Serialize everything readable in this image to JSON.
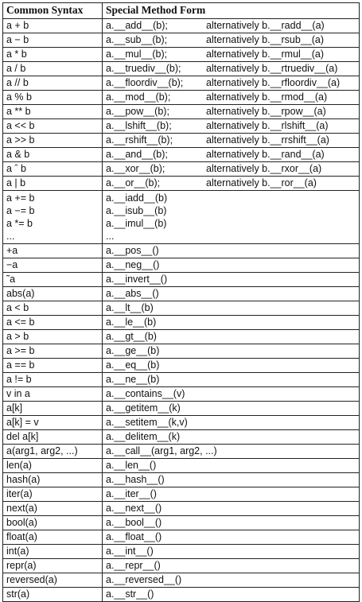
{
  "headers": {
    "syntax": "Common Syntax",
    "method": "Special Method Form"
  },
  "rows": [
    {
      "syntax": "a + b",
      "method": "a.__add__(b);",
      "alt": "alternatively b.__radd__(a)"
    },
    {
      "syntax": "a − b",
      "method": "a.__sub__(b);",
      "alt": "alternatively b.__rsub__(a)"
    },
    {
      "syntax": "a * b",
      "method": "a.__mul__(b);",
      "alt": "alternatively b.__rmul__(a)"
    },
    {
      "syntax": "a / b",
      "method": "a.__truediv__(b);",
      "alt": "alternatively b.__rtruediv__(a)"
    },
    {
      "syntax": "a // b",
      "method": "a.__floordiv__(b);",
      "alt": "alternatively b.__rfloordiv__(a)"
    },
    {
      "syntax": "a % b",
      "method": "a.__mod__(b);",
      "alt": "alternatively b.__rmod__(a)"
    },
    {
      "syntax": "a ** b",
      "method": "a.__pow__(b);",
      "alt": "alternatively b.__rpow__(a)"
    },
    {
      "syntax": "a << b",
      "method": "a.__lshift__(b);",
      "alt": "alternatively b.__rlshift__(a)"
    },
    {
      "syntax": "a >> b",
      "method": "a.__rshift__(b);",
      "alt": "alternatively b.__rrshift__(a)"
    },
    {
      "syntax": "a & b",
      "method": "a.__and__(b);",
      "alt": "alternatively b.__rand__(a)"
    },
    {
      "syntax": "a ˆ b",
      "method": "a.__xor__(b);",
      "alt": "alternatively b.__rxor__(a)"
    },
    {
      "syntax": "a | b",
      "method": "a.__or__(b);",
      "alt": "alternatively b.__ror__(a)"
    }
  ],
  "inplace": {
    "syntax": [
      "a += b",
      "a −= b",
      "a *= b",
      "..."
    ],
    "method": [
      "a.__iadd__(b)",
      "a.__isub__(b)",
      "a.__imul__(b)",
      "..."
    ]
  },
  "rows2": [
    {
      "syntax": "+a",
      "method": "a.__pos__()"
    },
    {
      "syntax": "−a",
      "method": "a.__neg__()"
    },
    {
      "syntax": "˜a",
      "method": "a.__invert__()"
    },
    {
      "syntax": "abs(a)",
      "method": "a.__abs__()"
    },
    {
      "syntax": "a < b",
      "method": "a.__lt__(b)"
    },
    {
      "syntax": "a <= b",
      "method": "a.__le__(b)"
    },
    {
      "syntax": "a > b",
      "method": "a.__gt__(b)"
    },
    {
      "syntax": "a >= b",
      "method": "a.__ge__(b)"
    },
    {
      "syntax": "a == b",
      "method": "a.__eq__(b)"
    },
    {
      "syntax": "a != b",
      "method": "a.__ne__(b)"
    },
    {
      "syntax": "v in a",
      "method": "a.__contains__(v)"
    },
    {
      "syntax": "a[k]",
      "method": "a.__getitem__(k)"
    },
    {
      "syntax": "a[k] = v",
      "method": "a.__setitem__(k,v)"
    },
    {
      "syntax": "del a[k]",
      "method": "a.__delitem__(k)"
    },
    {
      "syntax": "a(arg1, arg2, ...)",
      "method": "a.__call__(arg1, arg2, ...)"
    },
    {
      "syntax": "len(a)",
      "method": "a.__len__()"
    },
    {
      "syntax": "hash(a)",
      "method": "a.__hash__()"
    },
    {
      "syntax": "iter(a)",
      "method": "a.__iter__()"
    },
    {
      "syntax": "next(a)",
      "method": "a.__next__()"
    },
    {
      "syntax": "bool(a)",
      "method": "a.__bool__()"
    },
    {
      "syntax": "float(a)",
      "method": "a.__float__()"
    },
    {
      "syntax": "int(a)",
      "method": "a.__int__()"
    },
    {
      "syntax": "repr(a)",
      "method": "a.__repr__()"
    },
    {
      "syntax": "reversed(a)",
      "method": "a.__reversed__()"
    },
    {
      "syntax": "str(a)",
      "method": "a.__str__()"
    }
  ]
}
